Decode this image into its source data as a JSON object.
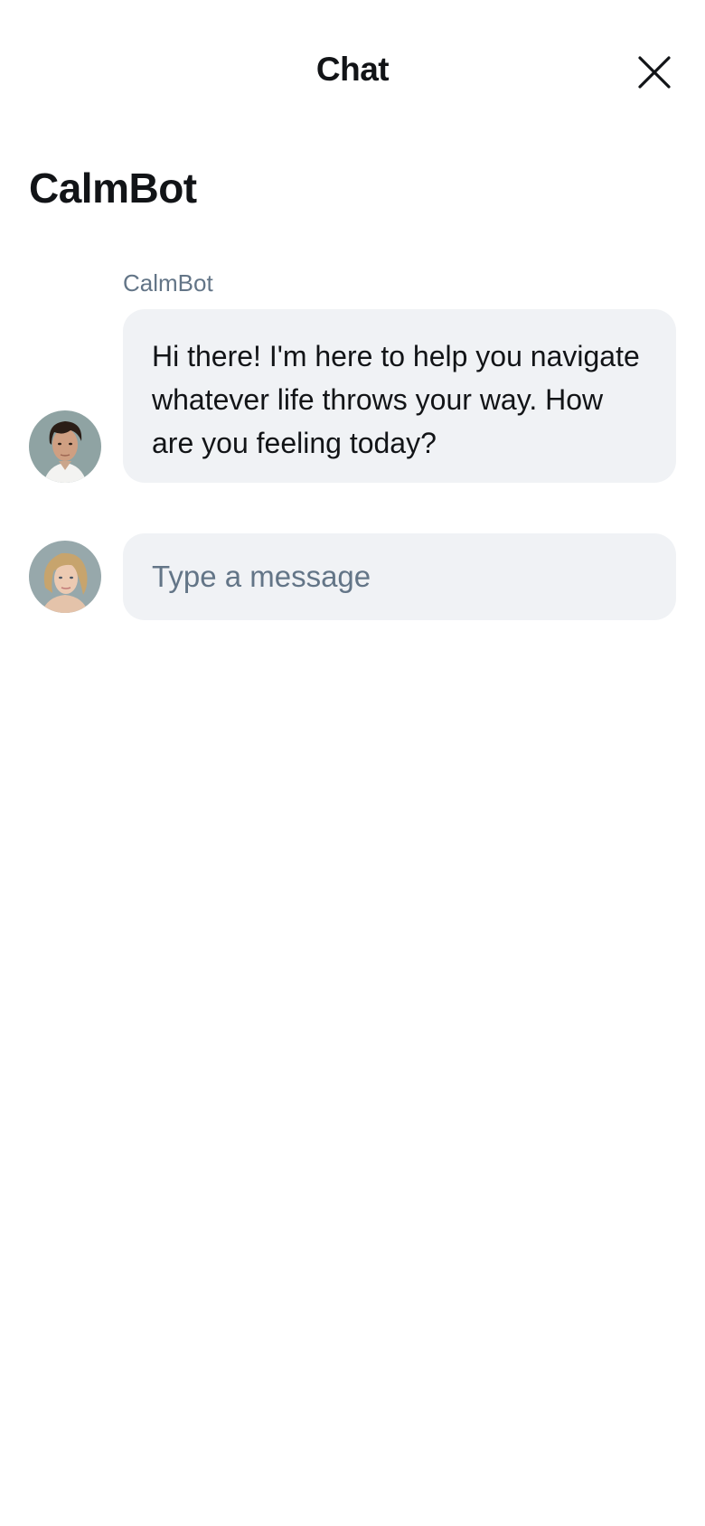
{
  "header": {
    "title": "Chat",
    "close_icon": "close-icon"
  },
  "bot": {
    "name": "CalmBot"
  },
  "messages": [
    {
      "sender": "CalmBot",
      "text": "Hi there! I'm here to help you navigate whatever life throws your way. How are you feeling today?"
    }
  ],
  "composer": {
    "placeholder": "Type a message",
    "value": ""
  },
  "colors": {
    "bubble_bg": "#f0f2f5",
    "muted_text": "#637587",
    "text": "#121417",
    "background": "#ffffff"
  }
}
